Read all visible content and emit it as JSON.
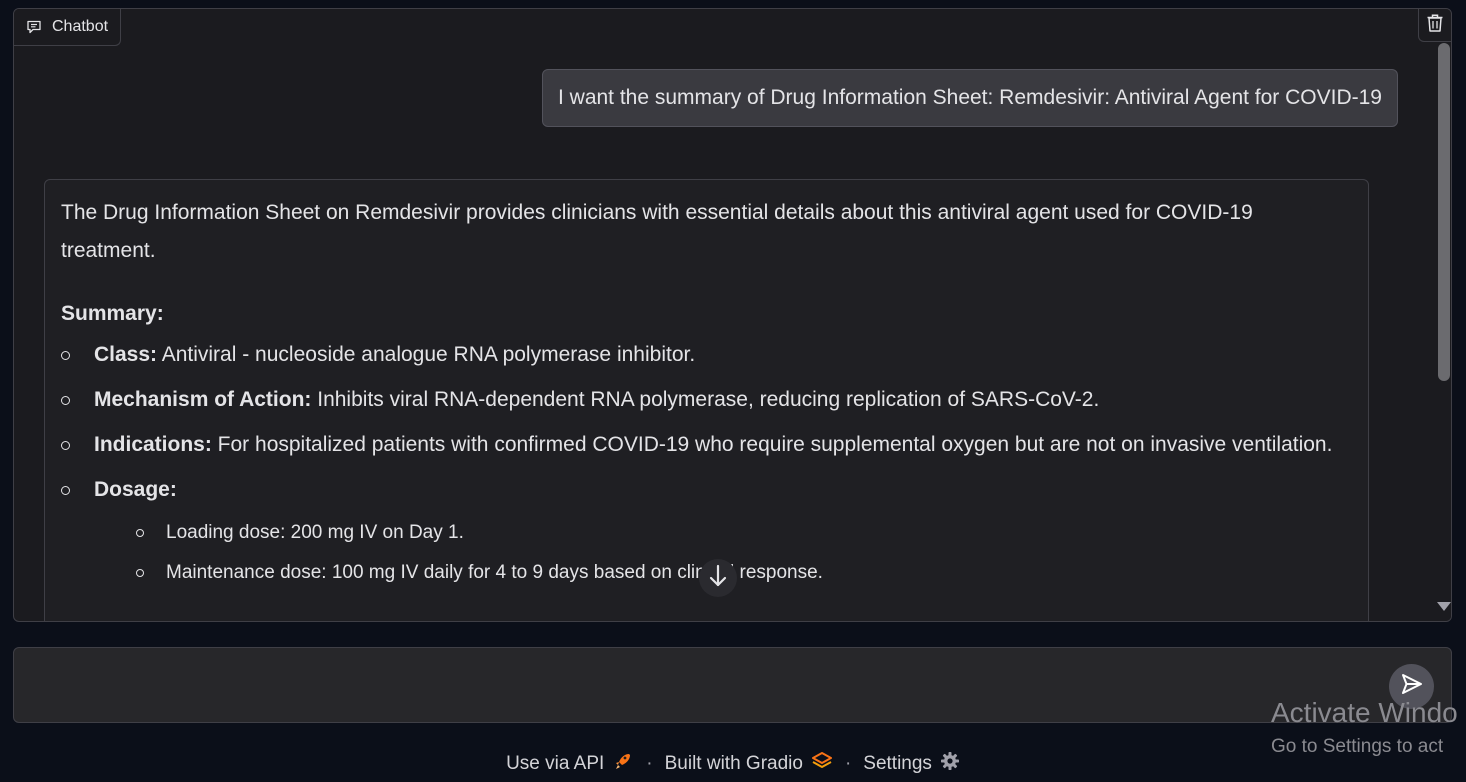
{
  "chatbot": {
    "label": "Chatbot",
    "user_message": "I want the summary of Drug Information Sheet: Remdesivir: Antiviral Agent for COVID-19",
    "bot": {
      "intro": "The Drug Information Sheet on Remdesivir provides clinicians with essential details about this antiviral agent used for COVID-19 treatment.",
      "summary_title": "Summary:",
      "items": [
        {
          "label": "Class:",
          "text": " Antiviral - nucleoside analogue RNA polymerase inhibitor."
        },
        {
          "label": "Mechanism of Action:",
          "text": " Inhibits viral RNA-dependent RNA polymerase, reducing replication of SARS-CoV-2."
        },
        {
          "label": "Indications:",
          "text": " For hospitalized patients with confirmed COVID-19 who require supplemental oxygen but are not on invasive ventilation."
        },
        {
          "label": "Dosage:",
          "text": ""
        }
      ],
      "dosage_items": [
        "Loading dose: 200 mg IV on Day 1.",
        "Maintenance dose: 100 mg IV daily for 4 to 9 days based on clinical response."
      ]
    }
  },
  "input": {
    "value": "",
    "placeholder": ""
  },
  "footer": {
    "api_label": "Use via API",
    "gradio_label": "Built with Gradio",
    "settings_label": "Settings",
    "separator": "·"
  },
  "watermark": {
    "line1": "Activate Windo",
    "line2": "Go to Settings to act"
  },
  "icons": {
    "chat": "chat-bubble-icon",
    "trash": "trash-icon",
    "scroll_down": "arrow-down-icon",
    "send": "send-icon",
    "api": "rocket-icon",
    "gradio": "gradio-logo-icon",
    "settings": "gear-icon"
  },
  "colors": {
    "background": "#0b0f19",
    "panel": "#1b1b1f",
    "user_bubble": "#3a3a40",
    "accent_orange": "#f97316"
  }
}
